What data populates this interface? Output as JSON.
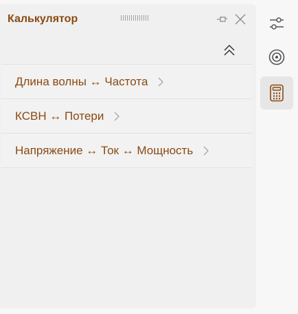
{
  "panel": {
    "title": "Калькулятор",
    "icons": {
      "grip": "drag-grip",
      "pin": "pin-icon",
      "close": "close-icon",
      "collapse": "double-chevron-up-icon"
    }
  },
  "list": {
    "items": [
      {
        "label": "Длина волны ↔ Частота"
      },
      {
        "label": "КСВН ↔ Потери"
      },
      {
        "label": "Напряжение ↔ Ток ↔ Мощность"
      }
    ]
  },
  "sidebar": {
    "items": [
      {
        "icon": "sliders-icon",
        "active": false
      },
      {
        "icon": "target-icon",
        "active": false
      },
      {
        "icon": "calculator-icon",
        "active": true
      }
    ]
  },
  "colors": {
    "accent": "#8a4a12",
    "active_bg": "#e6e6e6",
    "panel_bg": "#f0f0f0",
    "icon": "#555555"
  }
}
